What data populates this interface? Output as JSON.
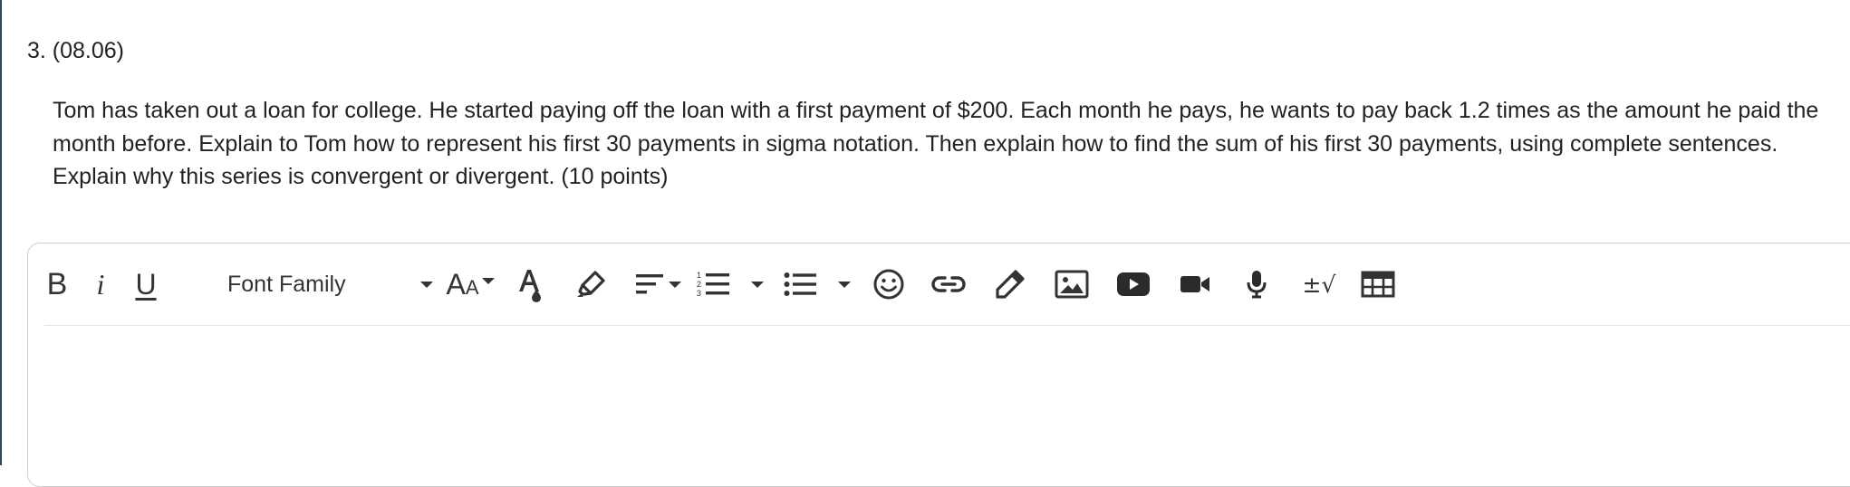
{
  "question": {
    "number": "3. (08.06)",
    "text": "Tom has taken out a loan for college. He started paying off the loan with a first payment of $200. Each month he pays, he wants to pay back 1.2 times as the amount he paid the month before. Explain to Tom how to represent his first 30 payments in sigma notation. Then explain how to find the sum of his first 30 payments, using complete sentences. Explain why this series is convergent or divergent. (10 points)"
  },
  "editor": {
    "toolbar": {
      "bold_label": "B",
      "italic_label": "i",
      "underline_label": "U",
      "font_family_label": "Font Family",
      "font_size_big": "A",
      "font_size_small": "A",
      "math_label": "±√",
      "icons": [
        "bold-icon",
        "italic-icon",
        "underline-icon",
        "font-size-icon",
        "font-color-icon",
        "highlight-icon",
        "align-icon",
        "numbered-list-icon",
        "bullet-list-icon",
        "emoji-icon",
        "link-icon",
        "draw-icon",
        "image-icon",
        "youtube-icon",
        "video-icon",
        "microphone-icon",
        "math-icon",
        "table-icon"
      ]
    },
    "body_text": ""
  },
  "colors": {
    "text": "#222222",
    "icon": "#333333",
    "border": "#cfcfcf",
    "left_edge": "#33475b"
  }
}
